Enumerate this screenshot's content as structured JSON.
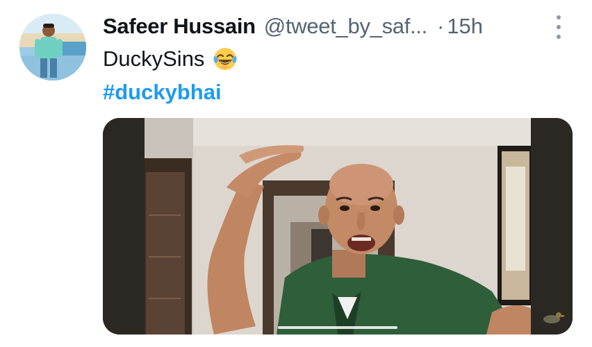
{
  "tweet": {
    "author": {
      "display_name": "Safeer Hussain",
      "handle": "@tweet_by_saf...",
      "avatar_icon": "profile-photo"
    },
    "separator": "·",
    "time": "15h",
    "more_icon": "vertical-ellipsis-icon",
    "text": "DuckySins",
    "emoji": "face-with-tears-of-joy",
    "hashtag": "#duckybhai",
    "media": {
      "type": "video",
      "watermark_icon": "duck-logo"
    }
  },
  "colors": {
    "text_primary": "#0f1419",
    "text_secondary": "#536471",
    "link": "#1d9bf0",
    "background": "#ffffff"
  }
}
